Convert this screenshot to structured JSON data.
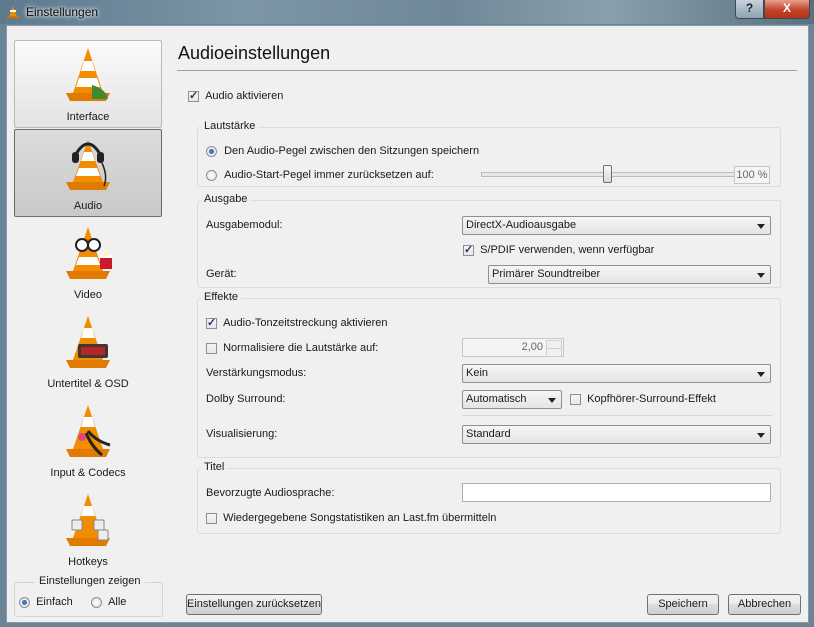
{
  "window": {
    "title": "Einstellungen",
    "help_label": "?",
    "close_label": "X"
  },
  "sidebar": {
    "items": [
      {
        "label": "Interface",
        "icon": "cone-icon"
      },
      {
        "label": "Audio",
        "icon": "cone-headphones-icon"
      },
      {
        "label": "Video",
        "icon": "cone-glasses-icon"
      },
      {
        "label": "Untertitel & OSD",
        "icon": "cone-subtitles-icon"
      },
      {
        "label": "Input & Codecs",
        "icon": "cone-cable-icon"
      },
      {
        "label": "Hotkeys",
        "icon": "cone-keyboard-icon"
      }
    ],
    "active": "Audio",
    "mode": {
      "title": "Einstellungen zeigen",
      "simple": "Einfach",
      "all": "Alle",
      "selected": "Einfach"
    }
  },
  "panel": {
    "title": "Audioeinstellungen",
    "enable_audio": "Audio aktivieren",
    "volume": {
      "title": "Lautstärke",
      "save_level": "Den Audio-Pegel zwischen den Sitzungen speichern",
      "reset_level": "Audio-Start-Pegel immer zurücksetzen auf:",
      "level_value": "100 %",
      "level_fraction": 0.5
    },
    "output": {
      "title": "Ausgabe",
      "module_label": "Ausgabemodul:",
      "module_value": "DirectX-Audioausgabe",
      "spdif": "S/PDIF verwenden, wenn verfügbar",
      "device_label": "Gerät:",
      "device_value": "Primärer Soundtreiber"
    },
    "effects": {
      "title": "Effekte",
      "time_stretch": "Audio-Tonzeitstreckung aktivieren",
      "normalize": "Normalisiere die Lautstärke auf:",
      "normalize_value": "2,00",
      "gain_label": "Verstärkungsmodus:",
      "gain_value": "Kein",
      "dolby_label": "Dolby Surround:",
      "dolby_value": "Automatisch",
      "headphone": "Kopfhörer-Surround-Effekt",
      "vis_label": "Visualisierung:",
      "vis_value": "Standard"
    },
    "track": {
      "title": "Titel",
      "lang_label": "Bevorzugte Audiosprache:",
      "lang_value": "",
      "lastfm": "Wiedergegebene Songstatistiken an Last.fm übermitteln"
    }
  },
  "buttons": {
    "reset": "Einstellungen zurücksetzen",
    "save": "Speichern",
    "cancel": "Abbrechen"
  }
}
